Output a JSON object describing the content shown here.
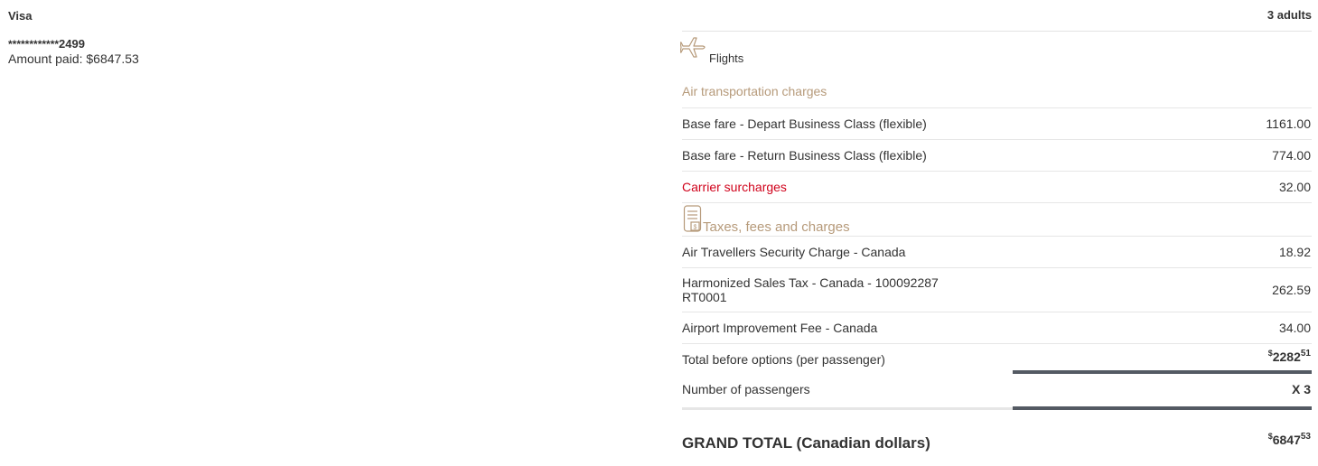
{
  "payment": {
    "card_type": "Visa",
    "card_mask": "************",
    "card_last4": "2499",
    "amount_paid": "Amount paid: $6847.53"
  },
  "breakdown": {
    "passengers_label": "3 adults",
    "flights_icon": "airplane-icon",
    "flights_label": "Flights",
    "air_transport_heading": "Air transportation charges",
    "fares": [
      {
        "desc": "Base fare - Depart Business Class (flexible)",
        "amount": "1161.00"
      },
      {
        "desc": "Base fare - Return Business Class (flexible)",
        "amount": "774.00"
      }
    ],
    "surcharge": {
      "desc": "Carrier surcharges",
      "amount": "32.00"
    },
    "taxes_icon": "receipt-icon",
    "taxes_heading": "Taxes, fees and charges",
    "taxes": [
      {
        "desc": "Air Travellers Security Charge - Canada",
        "amount": "18.92"
      },
      {
        "desc_line1": "Harmonized Sales Tax - Canada - 100092287",
        "desc_line2": "RT0001",
        "amount": "262.59"
      },
      {
        "desc": "Airport Improvement Fee - Canada",
        "amount": "34.00"
      }
    ],
    "total_before": {
      "desc": "Total before options (per passenger)",
      "currency": "$",
      "whole": "2282",
      "cents": "51"
    },
    "num_passengers": {
      "desc": "Number of passengers",
      "value": "X 3"
    },
    "grand_total": {
      "desc": "GRAND TOTAL (Canadian dollars)",
      "currency": "$",
      "whole": "6847",
      "cents": "53"
    }
  },
  "colors": {
    "accent_tan": "#b69a7a",
    "surcharge_red": "#d0021b",
    "bar_dark": "#545a63",
    "divider": "#e6e6e6"
  }
}
